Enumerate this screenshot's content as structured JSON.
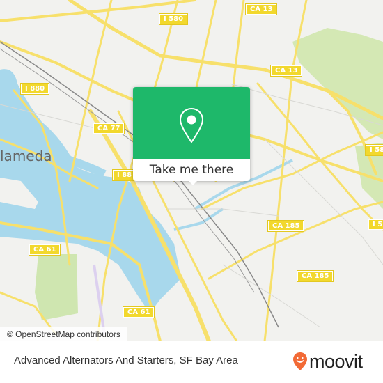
{
  "map": {
    "city_label": "lameda",
    "road_shields": [
      {
        "id": "i580-top",
        "label": "I 580"
      },
      {
        "id": "ca13-top",
        "label": "CA 13"
      },
      {
        "id": "ca13-mid",
        "label": "CA 13"
      },
      {
        "id": "i880-north",
        "label": "I 880"
      },
      {
        "id": "ca77",
        "label": "CA 77"
      },
      {
        "id": "i880-south",
        "label": "I 88"
      },
      {
        "id": "i580-east",
        "label": "I 58"
      },
      {
        "id": "i580-east2",
        "label": "I 5"
      },
      {
        "id": "ca185-north",
        "label": "CA 185"
      },
      {
        "id": "ca185-south",
        "label": "CA 185"
      },
      {
        "id": "ca61-west",
        "label": "CA 61"
      },
      {
        "id": "ca61-south",
        "label": "CA 61"
      }
    ],
    "colors": {
      "land": "#f2f2ef",
      "water": "#a8d8ec",
      "park": "#d4e8b4",
      "road": "#f7e06b",
      "shield": "#f2d82d"
    }
  },
  "popup": {
    "icon": "map-pin-icon",
    "button_label": "Take me there",
    "accent": "#1eb86a"
  },
  "attribution": "© OpenStreetMap contributors",
  "footer": {
    "title": "Advanced Alternators And Starters, SF Bay Area",
    "brand": "moovit",
    "brand_color": "#f26a36"
  }
}
